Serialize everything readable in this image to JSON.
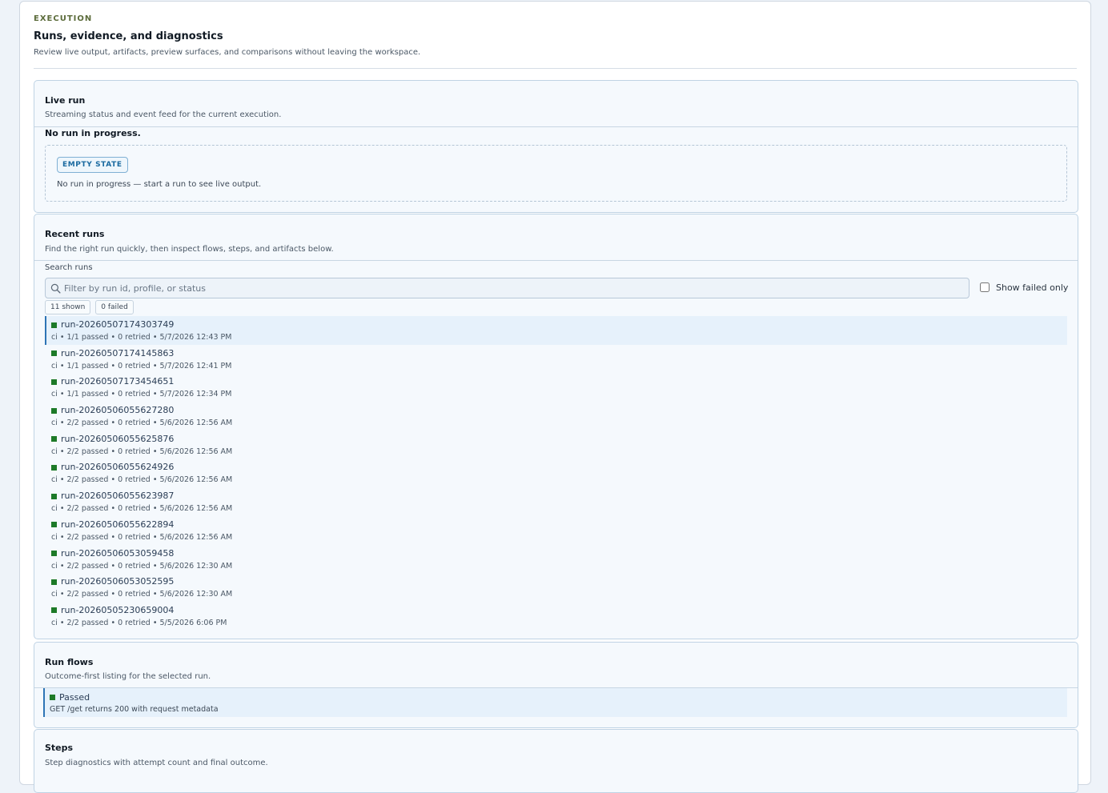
{
  "header": {
    "eyebrow": "EXECUTION",
    "title": "Runs, evidence, and diagnostics",
    "subtitle": "Review live output, artifacts, preview surfaces, and comparisons without leaving the workspace."
  },
  "live_run": {
    "title": "Live run",
    "subtitle": "Streaming status and event feed for the current execution.",
    "status": "No run in progress.",
    "empty_badge": "EMPTY STATE",
    "empty_text": "No run in progress — start a run to see live output."
  },
  "recent_runs": {
    "title": "Recent runs",
    "subtitle": "Find the right run quickly, then inspect flows, steps, and artifacts below.",
    "search_label": "Search runs",
    "search_placeholder": "Filter by run id, profile, or status",
    "search_value": "",
    "failed_toggle_label": "Show failed only",
    "failed_only": false,
    "shown_chip": "11 shown",
    "failed_chip": "0 failed",
    "status_color": "#1d7a28",
    "runs": [
      {
        "id": "run-20260507174303749",
        "meta": "ci • 1/1 passed • 0 retried • 5/7/2026 12:43 PM",
        "selected": true
      },
      {
        "id": "run-20260507174145863",
        "meta": "ci • 1/1 passed • 0 retried • 5/7/2026 12:41 PM",
        "selected": false
      },
      {
        "id": "run-20260507173454651",
        "meta": "ci • 1/1 passed • 0 retried • 5/7/2026 12:34 PM",
        "selected": false
      },
      {
        "id": "run-20260506055627280",
        "meta": "ci • 2/2 passed • 0 retried • 5/6/2026 12:56 AM",
        "selected": false
      },
      {
        "id": "run-20260506055625876",
        "meta": "ci • 2/2 passed • 0 retried • 5/6/2026 12:56 AM",
        "selected": false
      },
      {
        "id": "run-20260506055624926",
        "meta": "ci • 2/2 passed • 0 retried • 5/6/2026 12:56 AM",
        "selected": false
      },
      {
        "id": "run-20260506055623987",
        "meta": "ci • 2/2 passed • 0 retried • 5/6/2026 12:56 AM",
        "selected": false
      },
      {
        "id": "run-20260506055622894",
        "meta": "ci • 2/2 passed • 0 retried • 5/6/2026 12:56 AM",
        "selected": false
      },
      {
        "id": "run-20260506053059458",
        "meta": "ci • 2/2 passed • 0 retried • 5/6/2026 12:30 AM",
        "selected": false
      },
      {
        "id": "run-20260506053052595",
        "meta": "ci • 2/2 passed • 0 retried • 5/6/2026 12:30 AM",
        "selected": false
      },
      {
        "id": "run-20260505230659004",
        "meta": "ci • 2/2 passed • 0 retried • 5/5/2026 6:06 PM",
        "selected": false
      }
    ]
  },
  "run_flows": {
    "title": "Run flows",
    "subtitle": "Outcome-first listing for the selected run.",
    "flows": [
      {
        "status": "Passed",
        "description": "GET /get returns 200 with request metadata"
      }
    ]
  },
  "steps": {
    "title": "Steps",
    "subtitle": "Step diagnostics with attempt count and final outcome."
  }
}
